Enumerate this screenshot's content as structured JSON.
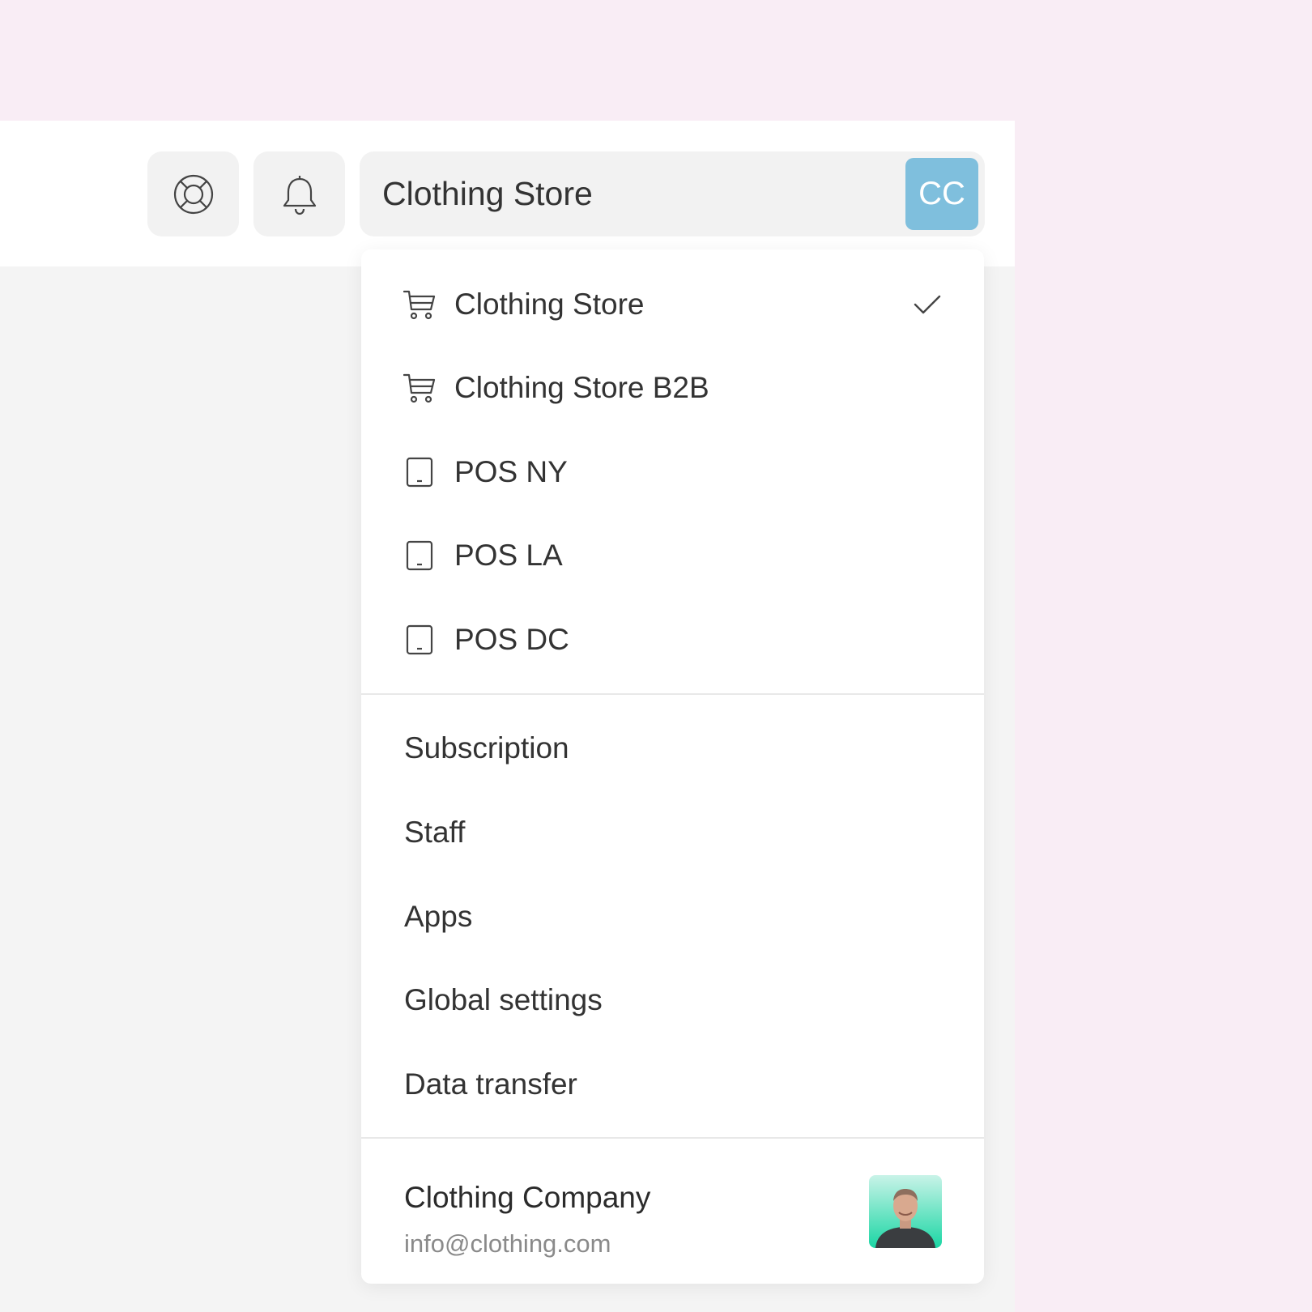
{
  "header": {
    "help_icon": "lifebuoy-icon",
    "notifications_icon": "bell-icon",
    "store_selector": {
      "label": "Clothing Store",
      "avatar_initials": "CC",
      "avatar_color": "#7fbfdd"
    }
  },
  "dropdown": {
    "channels": [
      {
        "label": "Clothing Store",
        "icon": "cart-icon",
        "selected": true
      },
      {
        "label": "Clothing Store B2B",
        "icon": "cart-icon",
        "selected": false
      },
      {
        "label": "POS NY",
        "icon": "tablet-icon",
        "selected": false
      },
      {
        "label": "POS LA",
        "icon": "tablet-icon",
        "selected": false
      },
      {
        "label": "POS DC",
        "icon": "tablet-icon",
        "selected": false
      }
    ],
    "settings": [
      {
        "label": "Subscription"
      },
      {
        "label": "Staff"
      },
      {
        "label": "Apps"
      },
      {
        "label": "Global settings"
      },
      {
        "label": "Data transfer"
      }
    ],
    "account": {
      "name": "Clothing Company",
      "email": "info@clothing.com"
    }
  },
  "colors": {
    "page_background": "#f9edf5",
    "topbar": "#ffffff",
    "content_background": "#f4f4f4",
    "button_background": "#f2f2f2"
  }
}
